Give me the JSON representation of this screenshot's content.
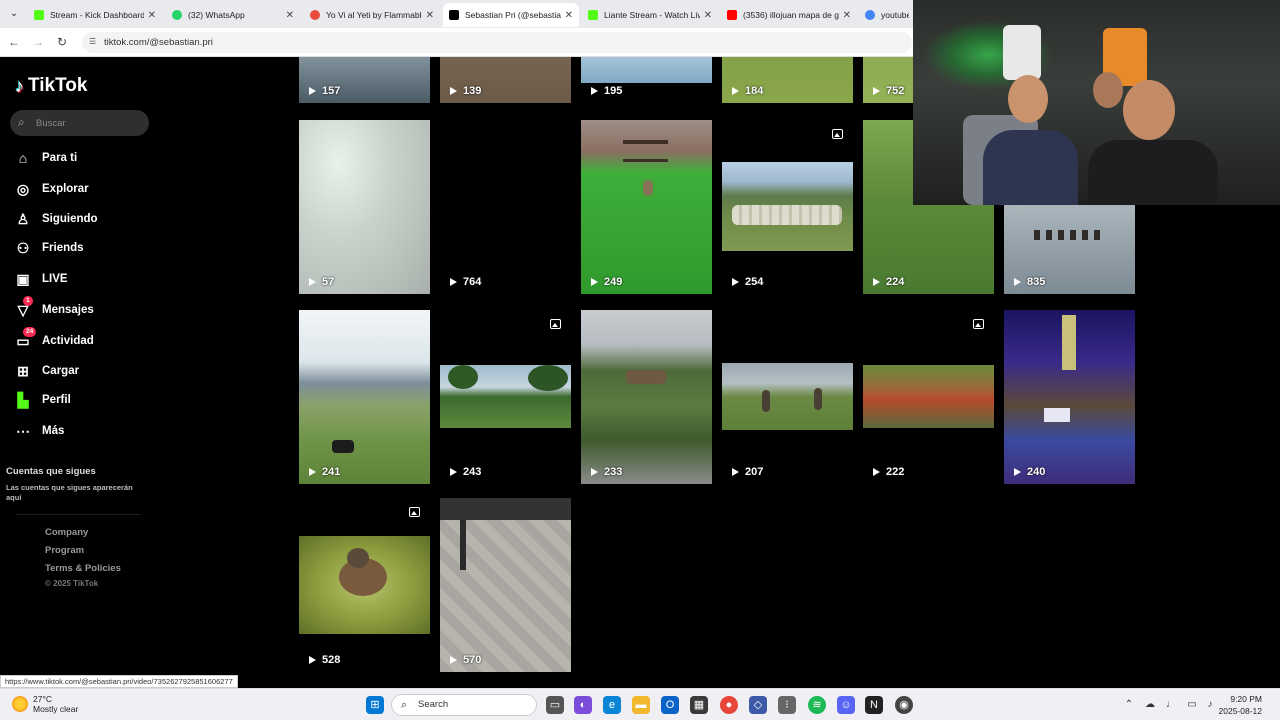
{
  "browser": {
    "tabs": [
      {
        "title": "Stream - Kick Dashboard",
        "icon": "kick-icon",
        "color": "#53fc18"
      },
      {
        "title": "(32) WhatsApp",
        "icon": "whatsapp-icon",
        "color": "#25d366"
      },
      {
        "title": "Yo Vi al Yeti by Flammable",
        "icon": "flammable-icon",
        "color": "#e74c3c"
      },
      {
        "title": "Sebastian Pri (@sebastian",
        "icon": "tiktok-icon",
        "color": "#000000"
      },
      {
        "title": "Liante Stream - Watch Liv",
        "icon": "kick-icon",
        "color": "#53fc18"
      },
      {
        "title": "(3536) illojuan mapa de g",
        "icon": "youtube-icon",
        "color": "#ff0000"
      },
      {
        "title": "youtube",
        "icon": "google-icon",
        "color": "#4285f4"
      }
    ],
    "url": "tiktok.com/@sebastian.pri",
    "status_url": "https://www.tiktok.com/@sebastian.pri/video/7352627925851606277"
  },
  "sidebar": {
    "logo": "TikTok",
    "search_placeholder": "Buscar",
    "nav": [
      {
        "label": "Para ti",
        "icon": "home-icon",
        "badge": ""
      },
      {
        "label": "Explorar",
        "icon": "compass-icon",
        "badge": ""
      },
      {
        "label": "Siguiendo",
        "icon": "user-icon",
        "badge": ""
      },
      {
        "label": "Friends",
        "icon": "friends-icon",
        "badge": ""
      },
      {
        "label": "LIVE",
        "icon": "live-icon",
        "badge": ""
      },
      {
        "label": "Mensajes",
        "icon": "inbox-icon",
        "badge": "1"
      },
      {
        "label": "Actividad",
        "icon": "activity-icon",
        "badge": "24"
      },
      {
        "label": "Cargar",
        "icon": "upload-icon",
        "badge": ""
      },
      {
        "label": "Perfil",
        "icon": "profile-icon",
        "badge": ""
      },
      {
        "label": "Más",
        "icon": "more-icon",
        "badge": ""
      }
    ],
    "following_title": "Cuentas que sigues",
    "following_sub": "Las cuentas que sigues aparecerán aquí",
    "footer": [
      "Company",
      "Program",
      "Terms & Policies"
    ],
    "copyright": "© 2025 TikTok"
  },
  "videos": {
    "row1": [
      "157",
      "139",
      "195",
      "184",
      "752"
    ],
    "row2": [
      "57",
      "764",
      "249",
      "254",
      "224",
      "835"
    ],
    "row3": [
      "241",
      "243",
      "233",
      "207",
      "222",
      "240"
    ],
    "row4": [
      "528",
      "570"
    ]
  },
  "taskbar": {
    "temp": "27°C",
    "weather": "Mostly clear",
    "search": "Search",
    "time": "9:20 PM",
    "date": "2025-08-12"
  }
}
